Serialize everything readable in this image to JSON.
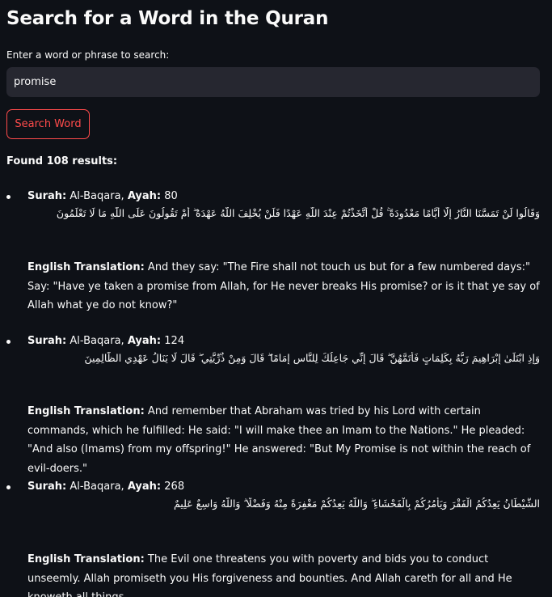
{
  "page": {
    "title": "Search for a Word in the Quran",
    "input_label": "Enter a word or phrase to search:",
    "input_value": "promise",
    "button_label": "Search Word",
    "found_text": "Found 108 results:"
  },
  "labels": {
    "surah": "Surah:",
    "ayah": "Ayah:",
    "translation": "English Translation:"
  },
  "colors": {
    "background": "#0e1117",
    "input_bg": "#262730",
    "accent": "#ff4b4b",
    "text": "#fafafa"
  },
  "results": [
    {
      "surah_name": "Al-Baqara,",
      "ayah_number": "80",
      "arabic": "وَقَالُوا لَنْ تَمَسَّنَا النَّارُ إِلَّا أَيَّامًا مَعْدُودَةً ۚ قُلْ أَتَّخَذْتُمْ عِنْدَ اللَّهِ عَهْدًا فَلَنْ يُخْلِفَ اللَّهُ عَهْدَهُ ۖ أَمْ تَقُولُونَ عَلَى اللَّهِ مَا لَا تَعْلَمُونَ",
      "translation": "And they say: \"The Fire shall not touch us but for a few numbered days:\" Say: \"Have ye taken a promise from Allah, for He never breaks His promise? or is it that ye say of Allah what ye do not know?\""
    },
    {
      "surah_name": "Al-Baqara,",
      "ayah_number": "124",
      "arabic": "وَإِذِ ابْتَلَىٰ إِبْرَاهِيمَ رَبُّهُ بِكَلِمَاتٍ فَأَتَمَّهُنَّ ۖ قَالَ إِنِّي جَاعِلُكَ لِلنَّاسِ إِمَامًا ۖ قَالَ وَمِنْ ذُرِّيَّتِي ۖ قَالَ لَا يَنَالُ عَهْدِي الظَّالِمِينَ",
      "translation": "And remember that Abraham was tried by his Lord with certain commands, which he fulfilled: He said: \"I will make thee an Imam to the Nations.\" He pleaded: \"And also (Imams) from my offspring!\" He answered: \"But My Promise is not within the reach of evil-doers.\""
    },
    {
      "surah_name": "Al-Baqara,",
      "ayah_number": "268",
      "arabic": "الشَّيْطَانُ يَعِدُكُمُ الْفَقْرَ وَيَأْمُرُكُمْ بِالْفَحْشَاءِ ۖ وَاللَّهُ يَعِدُكُمْ مَغْفِرَةً مِنْهُ وَفَضْلًا ۗ وَاللَّهُ وَاسِعٌ عَلِيمٌ",
      "translation": "The Evil one threatens you with poverty and bids you to conduct unseemly. Allah promiseth you His forgiveness and bounties. And Allah careth for all and He knoweth all things."
    }
  ]
}
